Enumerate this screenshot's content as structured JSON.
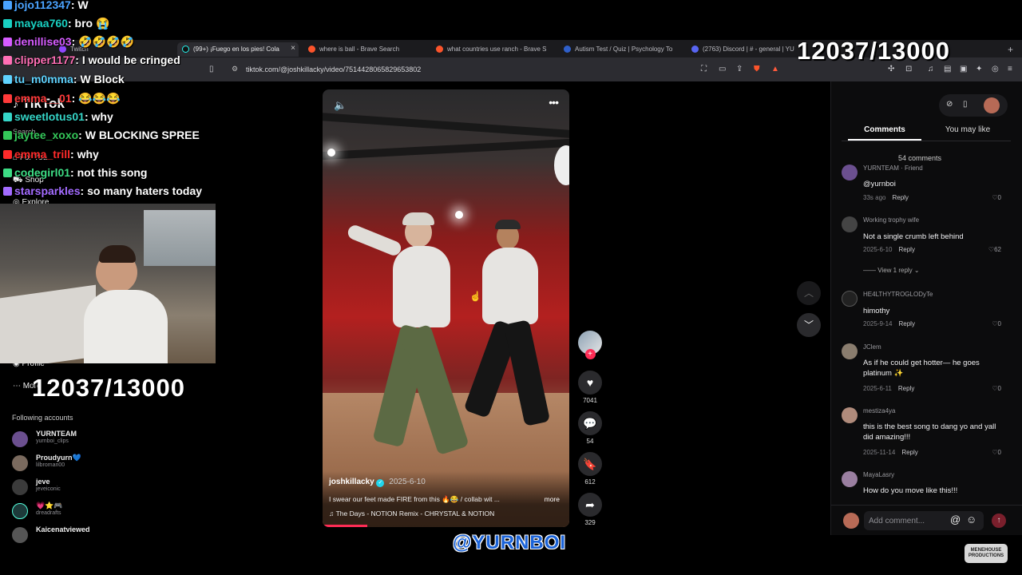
{
  "browser": {
    "tabs": [
      {
        "label": "Twitch",
        "active": false
      },
      {
        "label": "(99+) ¡Fuego en los pies! Cola",
        "active": true
      },
      {
        "label": "where is ball - Brave Search",
        "active": false
      },
      {
        "label": "what countries use ranch - Brave S",
        "active": false
      },
      {
        "label": "Autism Test / Quiz | Psychology To",
        "active": false
      },
      {
        "label": "(2763) Discord | # - general | YU",
        "active": false
      }
    ],
    "url": "tiktok.com/@joshkillacky/video/7514428065829653802"
  },
  "counter_top": "12037/13000",
  "counter_left": "12037/13000",
  "chat": [
    {
      "user": "jojo112347",
      "msg": "W",
      "color": "#4aa3ff"
    },
    {
      "user": "mayaa760",
      "msg": "bro 😭",
      "color": "#19d0c2"
    },
    {
      "user": "denillise03",
      "msg": "🤣🤣🤣🤣",
      "color": "#d65cff"
    },
    {
      "user": "clipper1177",
      "msg": "I would be cringed",
      "color": "#ff6fb5"
    },
    {
      "user": "tu_m0mma",
      "msg": "W Block",
      "color": "#5fd3ff"
    },
    {
      "user": "emma__01",
      "msg": "😂😂😂",
      "color": "#ff3a3a"
    },
    {
      "user": "sweetlotus01",
      "msg": "why",
      "color": "#35d6c8"
    },
    {
      "user": "jaytee_xoxo",
      "msg": "W BLOCKING SPREE",
      "color": "#34c759"
    },
    {
      "user": "emma_trill",
      "msg": "why",
      "color": "#ff2a2a"
    },
    {
      "user": "codegirl01",
      "msg": "not this song",
      "color": "#3ddc84"
    },
    {
      "user": "starsparkles",
      "msg": "so many haters today",
      "color": "#a36bff"
    }
  ],
  "tiktok": {
    "logo": "TikTok",
    "nav": [
      "Search",
      "For You",
      "Shop",
      "Explore",
      "Profile",
      "More"
    ],
    "following_title": "Following accounts",
    "following": [
      {
        "name": "YURNTEAM",
        "handle": "yurnboi_clips"
      },
      {
        "name": "Proudyurn💙",
        "handle": "lilbromari00"
      },
      {
        "name": "jeve",
        "handle": "jeveiconic"
      },
      {
        "name": "💗⭐🎮",
        "handle": "dreadrafts"
      },
      {
        "name": "Kaicenatviewed",
        "handle": ""
      }
    ]
  },
  "video": {
    "author": "joshkillacky",
    "date": "2025-6-10",
    "caption": "I swear our feet made FIRE from this 🔥😂 / collab wit ...",
    "more": "more",
    "music": "The Days - NOTION Remix - CHRYSTAL & NOTION",
    "progress": 0.18
  },
  "actions": {
    "likes": "7041",
    "comments": "54",
    "saves": "612",
    "shares": "329"
  },
  "panel": {
    "tab_comments": "Comments",
    "tab_like": "You may like",
    "count": "54 comments",
    "placeholder": "Add comment...",
    "comments": [
      {
        "author": "YURNTEAM · Friend",
        "text": "@yurnboi",
        "date": "33s ago",
        "reply": "Reply",
        "likes": "0",
        "color": "#6b4f8f"
      },
      {
        "author": "Working trophy wife",
        "text": "Not a single crumb left behind",
        "date": "2025-6-10",
        "reply": "Reply",
        "likes": "62",
        "color": "#444"
      },
      {
        "author": "HE4LTHYTROGLODyTe",
        "text": "himothy",
        "date": "2025-9-14",
        "reply": "Reply",
        "likes": "0",
        "color": "#222"
      },
      {
        "author": "JClem",
        "text": "As if he could get hotter— he goes platinum ✨",
        "date": "2025-6-11",
        "reply": "Reply",
        "likes": "0",
        "color": "#8a7d6e"
      },
      {
        "author": "mestiza4ya",
        "text": "this is the best song to dang yo and yall did amazing!!!",
        "date": "2025-11-14",
        "reply": "Reply",
        "likes": "0",
        "color": "#b08b7b"
      },
      {
        "author": "MayaLasry",
        "text": "How do you move like this!!!",
        "date": "",
        "reply": "",
        "likes": "",
        "color": "#9a7fa0"
      }
    ],
    "view_replies": "View 1 reply"
  },
  "watermark": "@YURNBOI",
  "corner_logo": "MENEHOUSE PRODUCTIONS"
}
